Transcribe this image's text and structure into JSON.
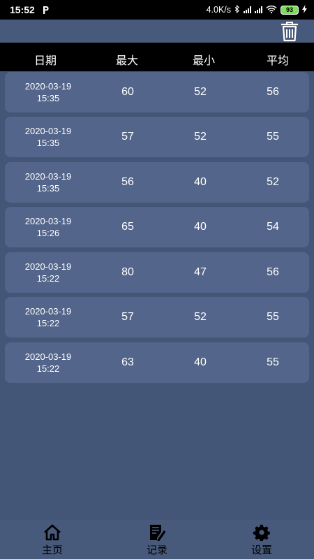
{
  "status_bar": {
    "time": "15:52",
    "network_speed": "4.0K/s",
    "battery": "93"
  },
  "toolbar": {
    "delete_icon": "trash-icon"
  },
  "table": {
    "headers": [
      "日期",
      "最大",
      "最小",
      "平均"
    ],
    "rows": [
      {
        "date": "2020-03-19",
        "time": "15:35",
        "max": "60",
        "min": "52",
        "avg": "56"
      },
      {
        "date": "2020-03-19",
        "time": "15:35",
        "max": "57",
        "min": "52",
        "avg": "55"
      },
      {
        "date": "2020-03-19",
        "time": "15:35",
        "max": "56",
        "min": "40",
        "avg": "52"
      },
      {
        "date": "2020-03-19",
        "time": "15:26",
        "max": "65",
        "min": "40",
        "avg": "54"
      },
      {
        "date": "2020-03-19",
        "time": "15:22",
        "max": "80",
        "min": "47",
        "avg": "56"
      },
      {
        "date": "2020-03-19",
        "time": "15:22",
        "max": "57",
        "min": "52",
        "avg": "55"
      },
      {
        "date": "2020-03-19",
        "time": "15:22",
        "max": "63",
        "min": "40",
        "avg": "55"
      }
    ]
  },
  "bottom_nav": {
    "items": [
      {
        "label": "主页",
        "icon": "home-icon"
      },
      {
        "label": "记录",
        "icon": "record-icon"
      },
      {
        "label": "设置",
        "icon": "settings-icon"
      }
    ]
  },
  "colors": {
    "background": "#435677",
    "row": "#53658a",
    "header": "#000000",
    "battery": "#7ee05a"
  }
}
